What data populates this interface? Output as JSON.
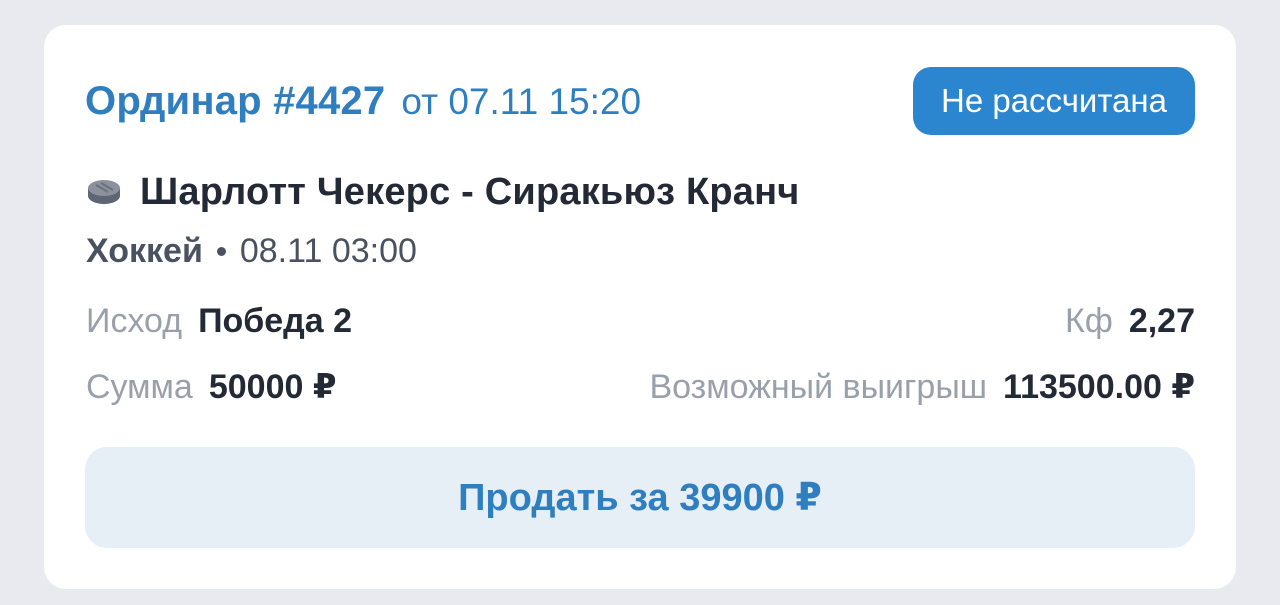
{
  "bet": {
    "title": "Ординар #4427",
    "date": "от 07.11 15:20",
    "status": "Не рассчитана"
  },
  "event": {
    "icon": "hockey-puck-icon",
    "name": "Шарлотт Чекерс - Сиракьюз Кранч",
    "sport": "Хоккей",
    "start_time": "08.11 03:00"
  },
  "details": {
    "outcome_label": "Исход",
    "outcome_value": "Победа 2",
    "coef_label": "Кф",
    "coef_value": "2,27",
    "amount_label": "Сумма",
    "amount_value": "50000 ₽",
    "payout_label": "Возможный выигрыш",
    "payout_value": "113500.00 ₽"
  },
  "actions": {
    "sell_label": "Продать за 39900 ₽"
  },
  "colors": {
    "accent": "#2f7fc0",
    "badge": "#2c85cf",
    "button_bg": "#e6eef6"
  }
}
